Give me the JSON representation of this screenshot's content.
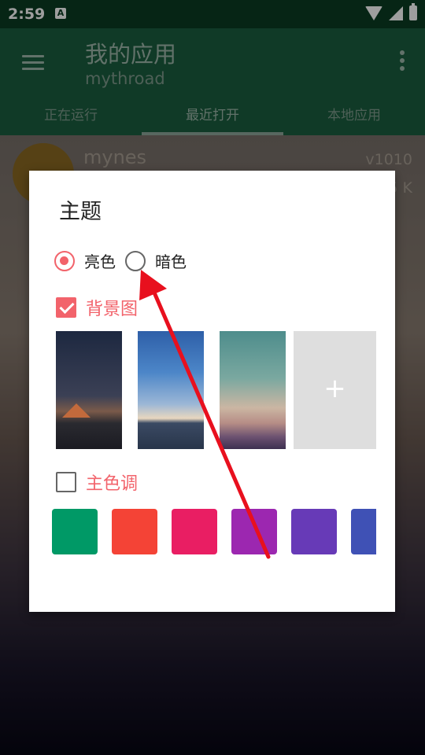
{
  "status_bar": {
    "time": "2:59",
    "notification_icon": "A"
  },
  "app_bar": {
    "title": "我的应用",
    "subtitle": "mythroad"
  },
  "tabs": [
    {
      "label": "正在运行"
    },
    {
      "label": "最近打开",
      "active": true
    },
    {
      "label": "本地应用"
    }
  ],
  "list": [
    {
      "name": "mynes",
      "version": "v1010",
      "size": "5 K"
    }
  ],
  "dialog": {
    "title": "主题",
    "theme_options": [
      {
        "label": "亮色",
        "checked": true
      },
      {
        "label": "暗色",
        "checked": false
      }
    ],
    "background_image": {
      "label": "背景图",
      "checked": true,
      "thumbnails": [
        "mountain-dusk-wallpaper",
        "blue-sky-sea-wallpaper",
        "teal-lowpoly-wallpaper"
      ],
      "add_label": "+"
    },
    "primary_color": {
      "label": "主色调",
      "checked": false,
      "swatches": [
        "#009966",
        "#f44336",
        "#e91e63",
        "#9c27b0",
        "#673ab7",
        "#3f51b5"
      ]
    }
  },
  "colors": {
    "accent": "#f2636b",
    "toolbar": "#1b5e3f",
    "annotation_arrow": "#e8101e"
  }
}
